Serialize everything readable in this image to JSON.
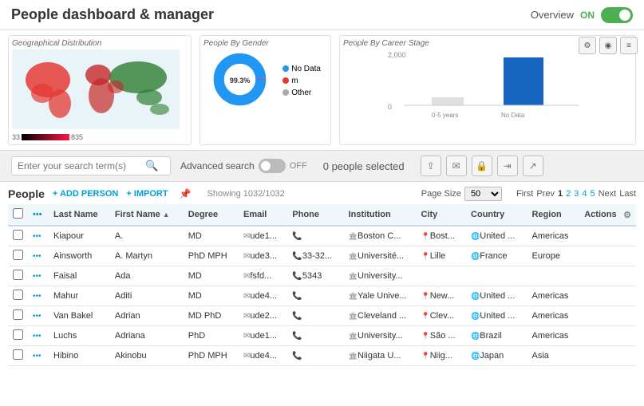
{
  "header": {
    "title": "People dashboard & manager",
    "overview_label": "Overview",
    "toggle_state": "ON"
  },
  "charts": {
    "geo": {
      "title": "Geographical Distribution",
      "val_min": "33",
      "val_max": "835"
    },
    "gender": {
      "title": "People By Gender",
      "donut_label": "99.3%",
      "legend": [
        {
          "label": "No Data",
          "color": "#2196F3"
        },
        {
          "label": "m",
          "color": "#e53935"
        },
        {
          "label": "Other",
          "color": "#aaa"
        }
      ]
    },
    "career": {
      "title": "People By Career Stage",
      "y_max": "2,000",
      "y_mid": "0",
      "x_labels": [
        "0-5 years",
        "No Data"
      ]
    }
  },
  "chart_icons": {
    "gear": "⚙",
    "chart": "◉",
    "list": "≡"
  },
  "search": {
    "placeholder": "Enter your search term(s)",
    "advanced_label": "Advanced search",
    "toggle_state": "OFF",
    "people_selected": "0 people selected"
  },
  "action_icons": {
    "share": "⇪",
    "email": "✉",
    "lock": "🔒",
    "export1": "⇥",
    "export2": "↗"
  },
  "people_section": {
    "label": "People",
    "add_label": "+ ADD PERSON",
    "import_label": "+ IMPORT",
    "showing": "Showing 1032/1032",
    "page_size_label": "Page Size",
    "page_size_value": "50",
    "pagination": {
      "first": "First",
      "prev": "Prev",
      "pages": [
        "1",
        "2",
        "3",
        "4",
        "5"
      ],
      "next": "Next",
      "last": "Last"
    }
  },
  "table": {
    "columns": [
      "",
      "",
      "Last Name",
      "First Name",
      "Degree",
      "Email",
      "Phone",
      "Institution",
      "City",
      "Country",
      "Region",
      "Actions"
    ],
    "rows": [
      {
        "last": "Kiapour",
        "first": "A.",
        "degree": "MD",
        "email": "ude1...",
        "phone": "📞",
        "institution": "Boston C...",
        "city": "Bost...",
        "country": "United ...",
        "region": "Americas"
      },
      {
        "last": "Ainsworth",
        "first": "A. Martyn",
        "degree": "PhD MPH",
        "email": "ude3...",
        "phone": "33-32...",
        "institution": "Université...",
        "city": "Lille",
        "country": "France",
        "region": "Europe"
      },
      {
        "last": "Faisal",
        "first": "Ada",
        "degree": "MD",
        "email": "fsfd...",
        "phone": "5343",
        "institution": "University...",
        "city": "",
        "country": "",
        "region": ""
      },
      {
        "last": "Mahur",
        "first": "Aditi",
        "degree": "MD",
        "email": "ude4...",
        "phone": "📞",
        "institution": "Yale Unive...",
        "city": "New...",
        "country": "United ...",
        "region": "Americas"
      },
      {
        "last": "Van Bakel",
        "first": "Adrian",
        "degree": "MD PhD",
        "email": "ude2...",
        "phone": "📞",
        "institution": "Cleveland ...",
        "city": "Clev...",
        "country": "United ...",
        "region": "Americas"
      },
      {
        "last": "Luchs",
        "first": "Adriana",
        "degree": "PhD",
        "email": "ude1...",
        "phone": "📞",
        "institution": "University...",
        "city": "São ...",
        "country": "Brazil",
        "region": "Americas"
      },
      {
        "last": "Hibino",
        "first": "Akinobu",
        "degree": "PhD MPH",
        "email": "ude4...",
        "phone": "📞",
        "institution": "Niigata U...",
        "city": "Niig...",
        "country": "Japan",
        "region": "Asia"
      }
    ]
  }
}
